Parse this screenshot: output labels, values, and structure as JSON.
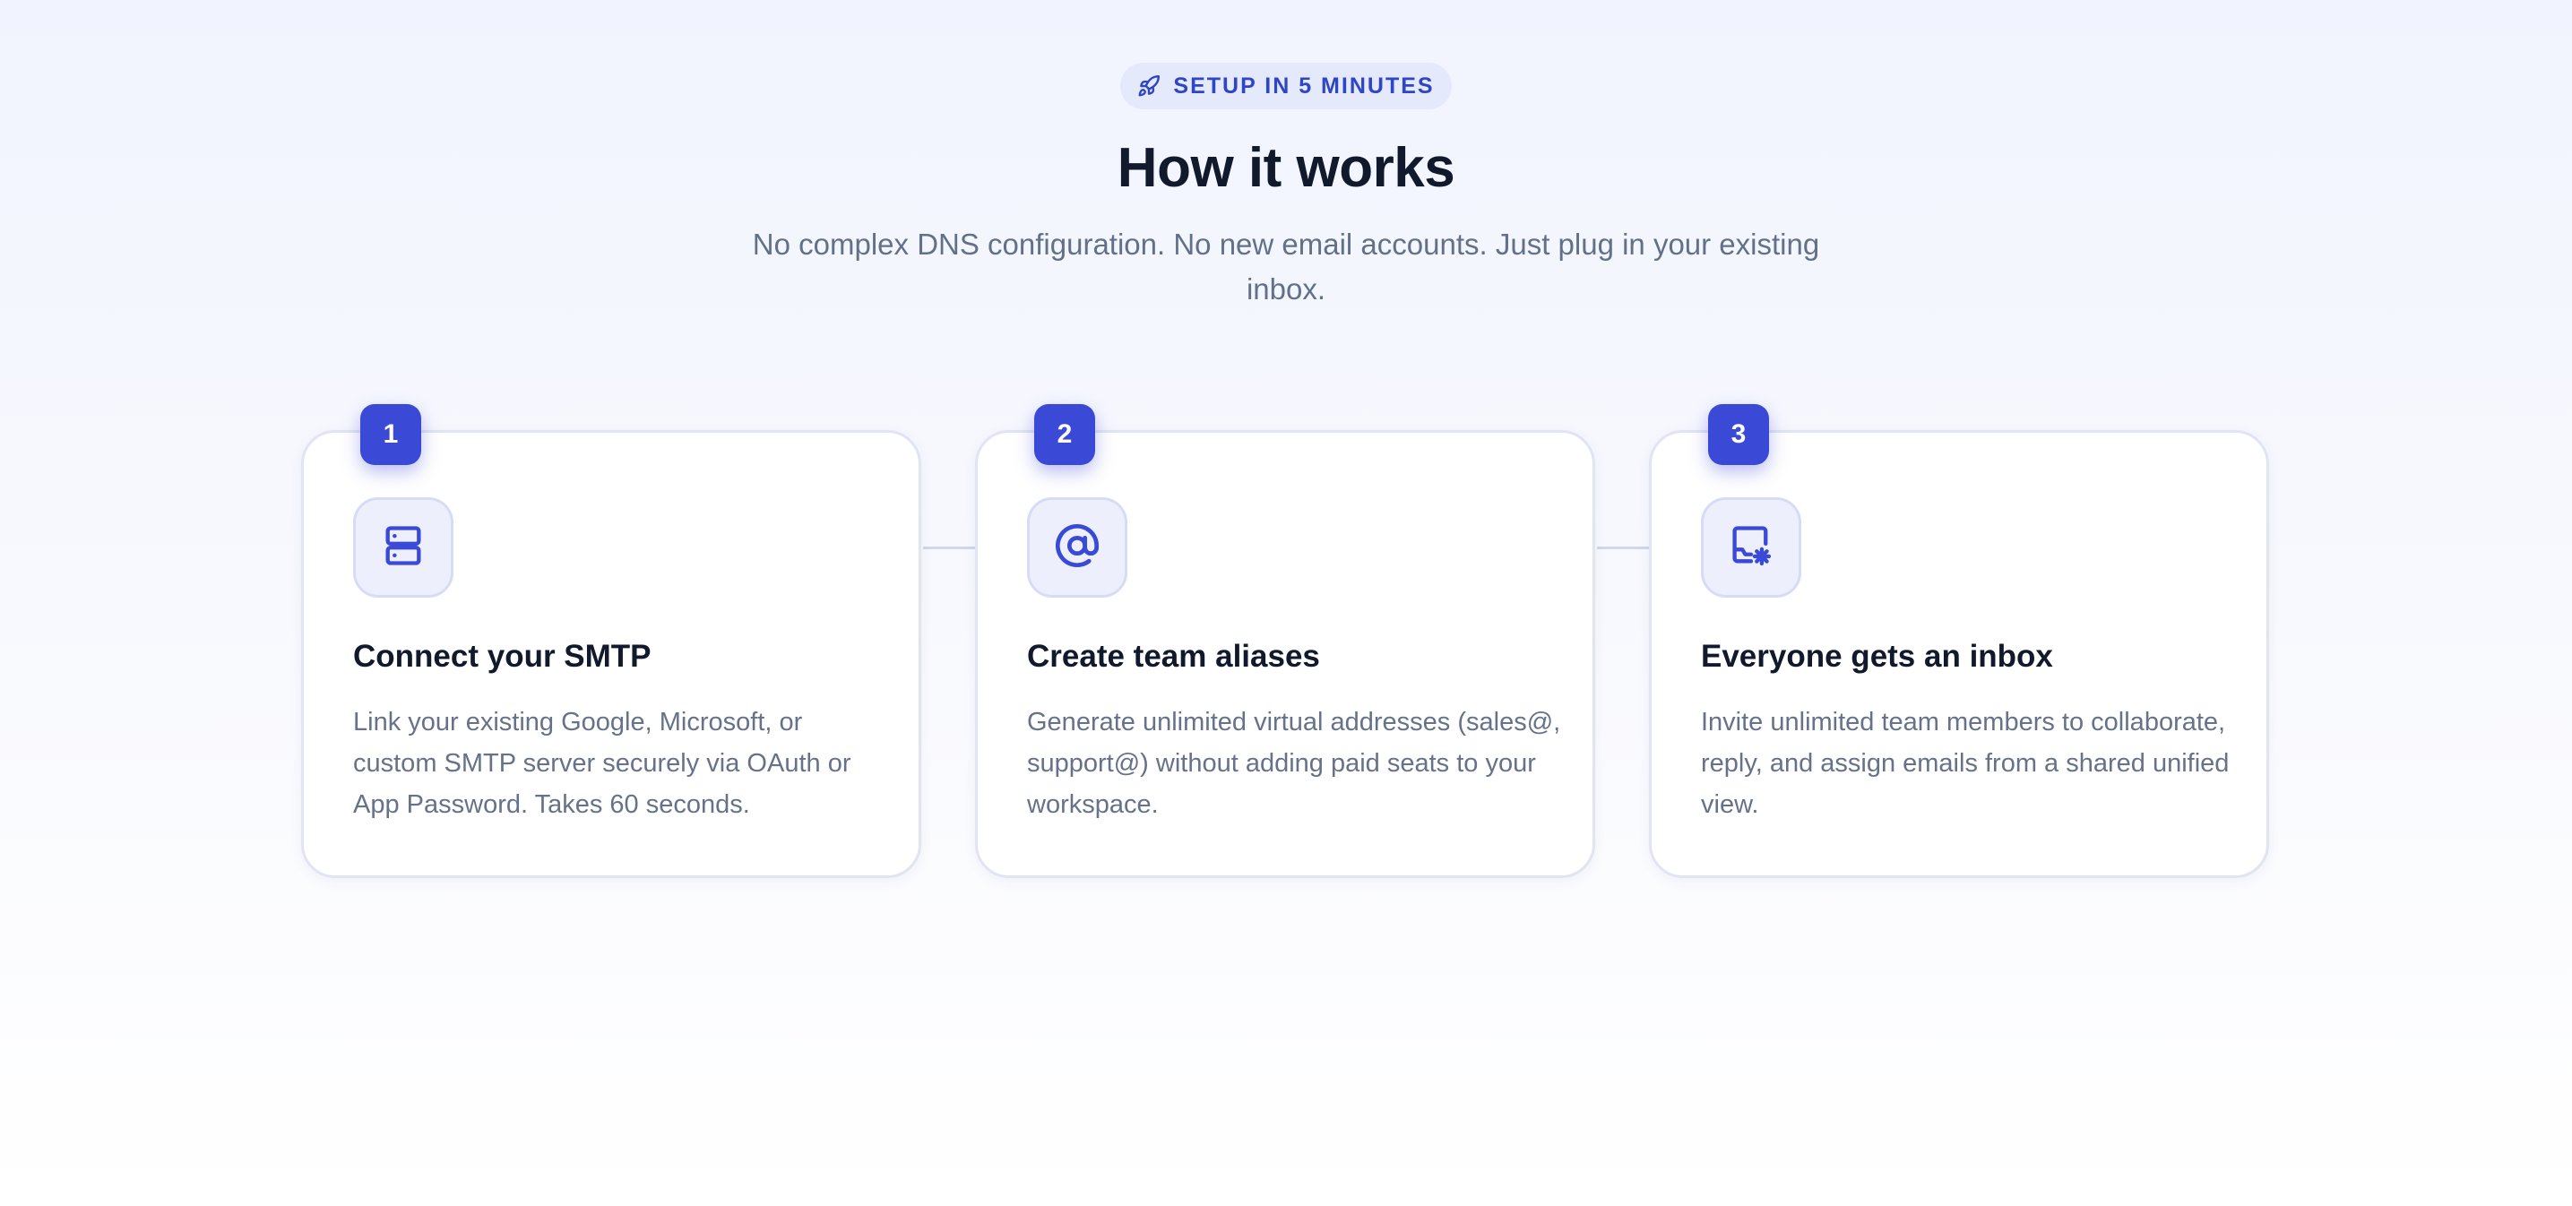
{
  "header": {
    "badge_icon": "rocket-icon",
    "badge_text": "SETUP IN 5 MINUTES",
    "title": "How it works",
    "subtitle": "No complex DNS configuration. No new email accounts. Just plug in your existing inbox."
  },
  "steps": [
    {
      "number": "1",
      "icon": "server-icon",
      "title": "Connect your SMTP",
      "description": "Link your existing Google, Microsoft, or custom SMTP server securely via OAuth or App Password. Takes 60 seconds."
    },
    {
      "number": "2",
      "icon": "at-sign-icon",
      "title": "Create team aliases",
      "description": "Generate unlimited virtual addresses (sales@, support@) without adding paid seats to your workspace."
    },
    {
      "number": "3",
      "icon": "inbox-settings-icon",
      "title": "Everyone gets an inbox",
      "description": "Invite unlimited team members to collaborate, reply, and assign emails from a shared unified view."
    }
  ],
  "colors": {
    "accent": "#3a49d6",
    "badge_bg": "#e4e9fb",
    "badge_text": "#2f45c8",
    "heading": "#111a2c",
    "body_text": "#667289"
  }
}
